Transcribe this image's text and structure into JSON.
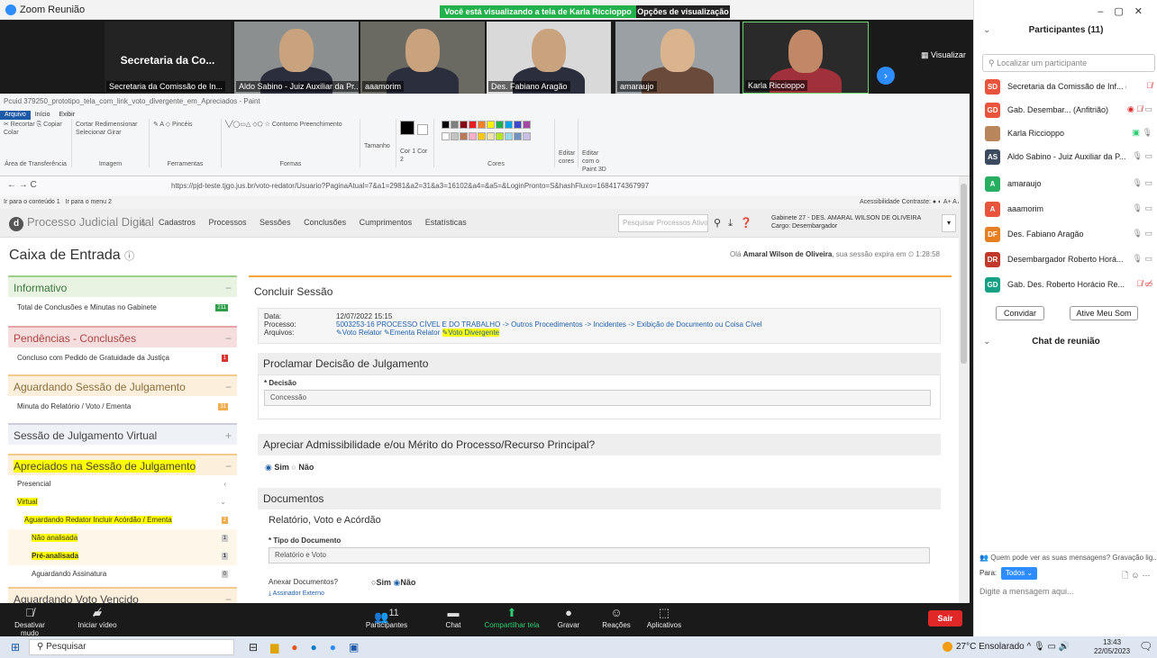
{
  "zoom": {
    "window_title": "Zoom Reunião",
    "share_banner": "Você está visualizando a tela de Karla Riccioppo",
    "view_options": "Opções de visualização ⌄",
    "visualizar": "Visualizar",
    "tiles": [
      {
        "label": "Secretaria da Co...",
        "name": "Secretaria da Comissão de In..."
      },
      {
        "name": "Aldo Sabino - Juiz Auxiliar da Pr..."
      },
      {
        "name": "aaamorim"
      },
      {
        "name": "Des. Fabiano Aragão"
      },
      {
        "name": "amaraujo"
      },
      {
        "name": "Karla Riccioppo"
      }
    ],
    "toolbar": {
      "mute": "Desativar mudo",
      "video": "Iniciar vídeo",
      "participants": "Participantes",
      "participants_count": "11",
      "chat": "Chat",
      "share": "Compartilhar tela",
      "record": "Gravar",
      "reactions": "Reações",
      "apps": "Aplicativos",
      "leave": "Sair"
    }
  },
  "paint": {
    "title": "Pcuid 379250_prototipo_tela_com_link_voto_divergente_em_Apreciados - Paint",
    "tabs": [
      "Arquivo",
      "Início",
      "Exibir"
    ],
    "groups": {
      "clipboard_label": "Área de Transferência",
      "clipboard_items": "✂ Recortar  ⎘ Copiar  Colar",
      "image_label": "Imagem",
      "image_items": "Cortar  Redimensionar  Selecionar  Girar",
      "tools_label": "Ferramentas",
      "tools_items": "✎ A  ◇  Pincéis",
      "shapes_label": "Formas",
      "shapes_items": "╲╱◯▭△ ◇⬠ ☆ Contorno  Preenchimento",
      "size_label": "Tamanho",
      "color1": "Cor 1",
      "color2": "Cor 2",
      "colors_label": "Cores",
      "edit_colors": "Editar cores",
      "edit_paint3d": "Editar com o Paint 3D"
    }
  },
  "browser": {
    "url": "https://pjd-teste.tjgo.jus.br/voto-redator/Usuario?PaginaAtual=7&a1=2981&a2=31&a3=16102&a4=&a5=&LoginPronto=S&hashFluxo=1684174367997",
    "skip_content": "Ir para o conteúdo",
    "skip_content_key": "1",
    "skip_menu": "Ir para o menu",
    "skip_menu_key": "2",
    "accessibility": "Acessibilidade  Contraste:  ● ◐  A+  A  A-"
  },
  "app": {
    "brand": "Processo Judicial Digital",
    "menu": [
      "Cadastros",
      "Processos",
      "Sessões",
      "Conclusões",
      "Cumprimentos",
      "Estatísticas"
    ],
    "search_placeholder": "Pesquisar Processos Ativos",
    "gabinete": "Gabinete 27 - DES. AMARAL WILSON DE OLIVEIRA",
    "cargo": "Cargo: Desembargador"
  },
  "page": {
    "title": "Caixa de Entrada",
    "greeting_prefix": "Olá",
    "user": "Amaral Wilson de Oliveira",
    "greeting_suffix": ", sua sessão expira em ⏲ 1:28:58",
    "left": {
      "informativo": "Informativo",
      "info_row": "Total de Conclusões e Minutas no Gabinete",
      "info_count": "211",
      "pendencias": "Pendências - Conclusões",
      "pend_row": "Concluso com Pedido de Gratuidade da Justiça",
      "pend_count": "1",
      "aguardando": "Aguardando Sessão de Julgamento",
      "ag_row": "Minuta do Relatório / Voto / Ementa",
      "ag_count": "31",
      "sessao_virtual": "Sessão de Julgamento Virtual",
      "apreciados": "Apreciados na Sessão de Julgamento",
      "presencial": "Presencial",
      "virtual": "Virtual",
      "aguard_redator": "Aguardando Redator Incluir Acórdão / Ementa",
      "aguard_redator_count": "2",
      "nao_analisada": "Não analisada",
      "nao_analisada_count": "1",
      "pre_analisada": "Pré-analisada",
      "pre_analisada_count": "1",
      "aguard_assinatura": "Aguardando Assinatura",
      "aguard_assinatura_count": "0",
      "voto_vencido": "Aguardando Voto Vencido"
    },
    "right": {
      "header": "Concluir Sessão",
      "data_label": "Data:",
      "data_value": "12/07/2022 15:15",
      "processo_label": "Processo:",
      "processo_value": "5003253-16 PROCESSO CÍVEL E DO TRABALHO -> Outros Procedimentos -> Incidentes -> Exibição de Documento ou Coisa Cível",
      "arquivos_label": "Arquivos:",
      "arquivo1": "Voto Relator",
      "arquivo2": "Ementa Relator",
      "arquivo3": "Voto Divergente",
      "proclamar": "Proclamar Decisão de Julgamento",
      "decisao_label": "* Decisão",
      "decisao_value": "Concessão",
      "apreciar": "Apreciar Admissibilidade e/ou Mérito do Processo/Recurso Principal?",
      "sim": "Sim",
      "nao": "Não",
      "documentos": "Documentos",
      "relatorio": "Relatório, Voto e Acórdão",
      "tipo_label": "* Tipo do Documento",
      "tipo_value": "Relatório e Voto",
      "anexar": "Anexar Documentos?",
      "assinador": "Assinador Externo"
    }
  },
  "participants": {
    "title": "Participantes (11)",
    "search": "Localizar um participante",
    "list": [
      {
        "initials": "SD",
        "color": "#e8543c",
        "name": "Secretaria da Comissão de Inf...  (Eu)"
      },
      {
        "initials": "GD",
        "color": "#e8543c",
        "name": "Gab. Desembar...  (Anfitrião)"
      },
      {
        "initials": "",
        "color": "#b8865a",
        "name": "Karla Riccioppo"
      },
      {
        "initials": "AS",
        "color": "#3b4a5e",
        "name": "Aldo Sabino - Juiz Auxiliar da P..."
      },
      {
        "initials": "A",
        "color": "#27ae60",
        "name": "amaraujo"
      },
      {
        "initials": "A",
        "color": "#e8543c",
        "name": "aaamorim"
      },
      {
        "initials": "DF",
        "color": "#e67e22",
        "name": "Des. Fabiano Aragão"
      },
      {
        "initials": "DR",
        "color": "#c0392b",
        "name": "Desembargador Roberto Horá..."
      },
      {
        "initials": "GD",
        "color": "#16a085",
        "name": "Gab. Des. Roberto Horácio Re..."
      }
    ],
    "invite": "Convidar",
    "unmute": "Ative Meu Som"
  },
  "chat": {
    "title": "Chat de reunião",
    "who_can_see": "Quem pode ver as suas mensagens? Gravação lig...",
    "to_label": "Para:",
    "to_value": "Todos ⌄",
    "placeholder": "Digite a mensagem aqui..."
  },
  "taskbar": {
    "search": "Pesquisar",
    "weather": "27°C  Ensolarado",
    "time": "13:43",
    "date": "22/05/2023"
  }
}
